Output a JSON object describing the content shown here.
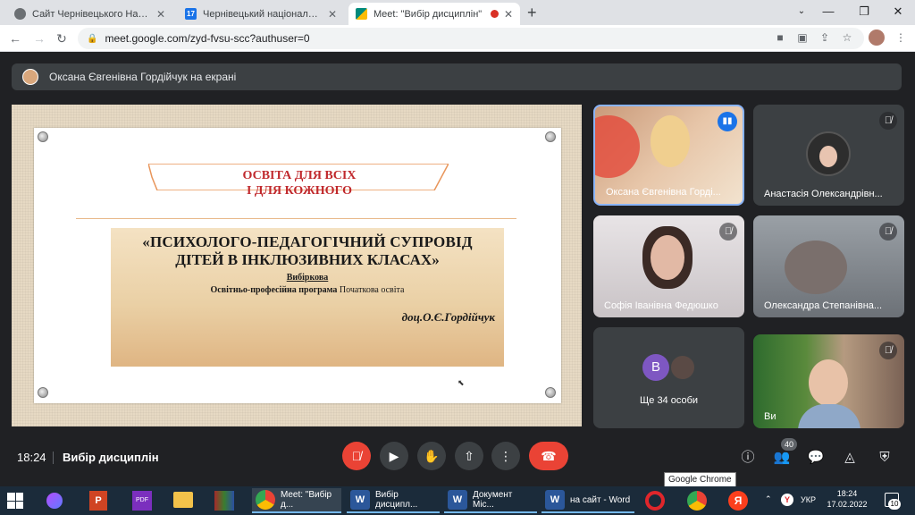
{
  "browser": {
    "tabs": [
      {
        "title": "Сайт Чернівецького Національ",
        "fav_color": "#6b6f73",
        "icon": "globe-icon"
      },
      {
        "title": "Чернівецький національний ун",
        "fav_color": "#1a73e8",
        "icon": "calendar-icon",
        "fav_text": "17"
      },
      {
        "title": "Meet: \"Вибір дисциплін\"",
        "fav_color": "#00897b",
        "icon": "meet-icon",
        "recording": true
      }
    ],
    "url": "meet.google.com/zyd-fvsu-scc?authuser=0"
  },
  "meet": {
    "presenting_label": "Оксана Євгенівна Гордійчук на екрані",
    "slide": {
      "title_line1": "ОСВІТА ДЛЯ ВСІХ",
      "title_line2": "І ДЛЯ КОЖНОГО",
      "course_line1": "«ПСИХОЛОГО-ПЕДАГОГІЧНИЙ СУПРОВІД",
      "course_line2": "ДІТЕЙ В ІНКЛЮЗИВНИХ КЛАСАХ»",
      "type": "Вибіркова",
      "program_label": "Освітньо-професійна програма",
      "program_value": "Початкова освіта",
      "author": "доц.О.Є.Гордійчук"
    },
    "participants": [
      {
        "name": "Оксана Євгенівна Горді...",
        "speaking": true
      },
      {
        "name": "Анастасія Олександрівн...",
        "muted": true
      },
      {
        "name": "Софія Іванівна Федюшко",
        "muted": true
      },
      {
        "name": "Олександра Степанівна...",
        "muted": true
      },
      {
        "name": "Ви",
        "muted": true
      }
    ],
    "others": {
      "label": "Ще 34 особи",
      "avatar_letter": "B"
    },
    "time": "18:24",
    "meeting_name": "Вибір дисциплін",
    "people_count": "40"
  },
  "tooltip": "Google Chrome",
  "taskbar": {
    "apps": [
      {
        "label": "Meet: \"Вибір д...",
        "icon": "chrome-icon"
      },
      {
        "label": "Вибір дисципл...",
        "icon": "word-icon"
      },
      {
        "label": "Документ Міс...",
        "icon": "word-icon"
      },
      {
        "label": "на сайт - Word",
        "icon": "word-icon"
      }
    ],
    "lang": "УКР",
    "clock_time": "18:24",
    "clock_date": "17.02.2022",
    "notif_count": "10"
  }
}
